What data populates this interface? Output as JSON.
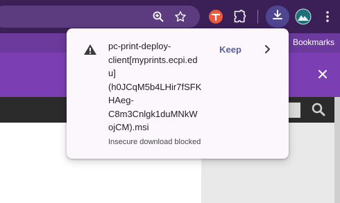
{
  "toolbar": {
    "icons": [
      "zoom-icon",
      "star-icon",
      "extension-red-icon",
      "puzzle-icon",
      "download-icon",
      "profile-icon",
      "kebab-menu-icon"
    ]
  },
  "bookmarks_bar": {
    "label": "Bookmarks"
  },
  "download_popup": {
    "filename": "pc-print-deploy-\nclient[myprints.ecpi.ed\nu]\n(h0JCqM5b4LHir7fSFK\nHAeg-\nC8m3Cnlgk1duMNkW\nojCM).msi",
    "status": "Insecure download blocked",
    "keep_label": "Keep",
    "warning_icon": "warning-triangle-icon",
    "chevron_icon": "chevron-right-icon"
  },
  "colors": {
    "toolbar_bg": "#3b1f57",
    "bookmarks_bg": "#6b3a9c",
    "band_bg": "#7b3fb3",
    "accent_keep": "#5b5fa0"
  }
}
